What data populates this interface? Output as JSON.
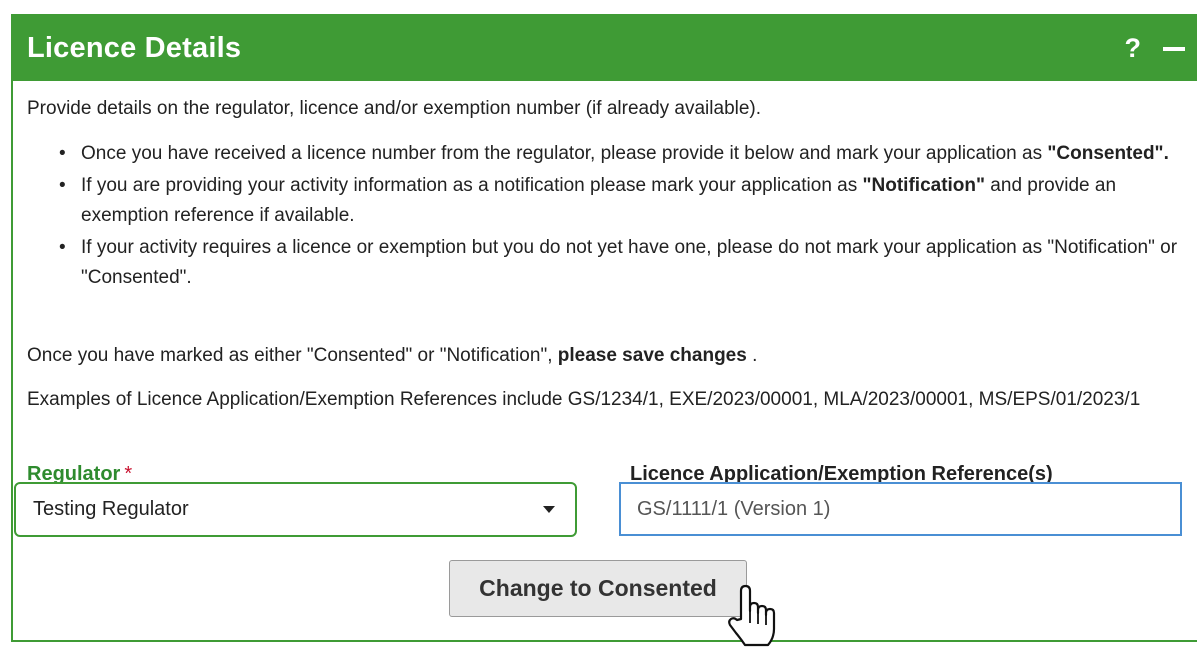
{
  "panel": {
    "title": "Licence Details",
    "help_icon": "?",
    "collapse_icon_name": "minus-icon"
  },
  "intro": "Provide details on the regulator, licence and/or exemption number (if already available).",
  "bullets": [
    {
      "text": "Once you have received a licence number from the regulator, please provide it below and mark your application as ",
      "bold": "\"Consented\".",
      "after": ""
    },
    {
      "text": "If you are providing your activity information as a notification please mark your application as ",
      "bold": "\"Notification\"",
      "after": " and provide an exemption reference if available."
    },
    {
      "text": "If your activity requires a licence or exemption but you do not yet have one, please do not mark your application as \"Notification\" or \"Consented\".",
      "bold": "",
      "after": ""
    }
  ],
  "save_line": {
    "text": "Once you have marked as either \"Consented\" or \"Notification\", ",
    "bold": "please save changes",
    "after": " ."
  },
  "examples": "Examples of Licence Application/Exemption References include GS/1234/1, EXE/2023/00001, MLA/2023/00001, MS/EPS/01/2023/1",
  "regulator": {
    "label": "Regulator",
    "required_marker": "*",
    "selected": "Testing Regulator"
  },
  "reference": {
    "label": "Licence Application/Exemption Reference(s)",
    "value": "GS/1111/1 (Version 1)"
  },
  "action": {
    "button_label": "Change to Consented"
  },
  "colors": {
    "header_green": "#3f9b35",
    "label_green": "#2e8b2e",
    "required_red": "#c8102e",
    "input_focus_blue": "#4a8fd4"
  }
}
